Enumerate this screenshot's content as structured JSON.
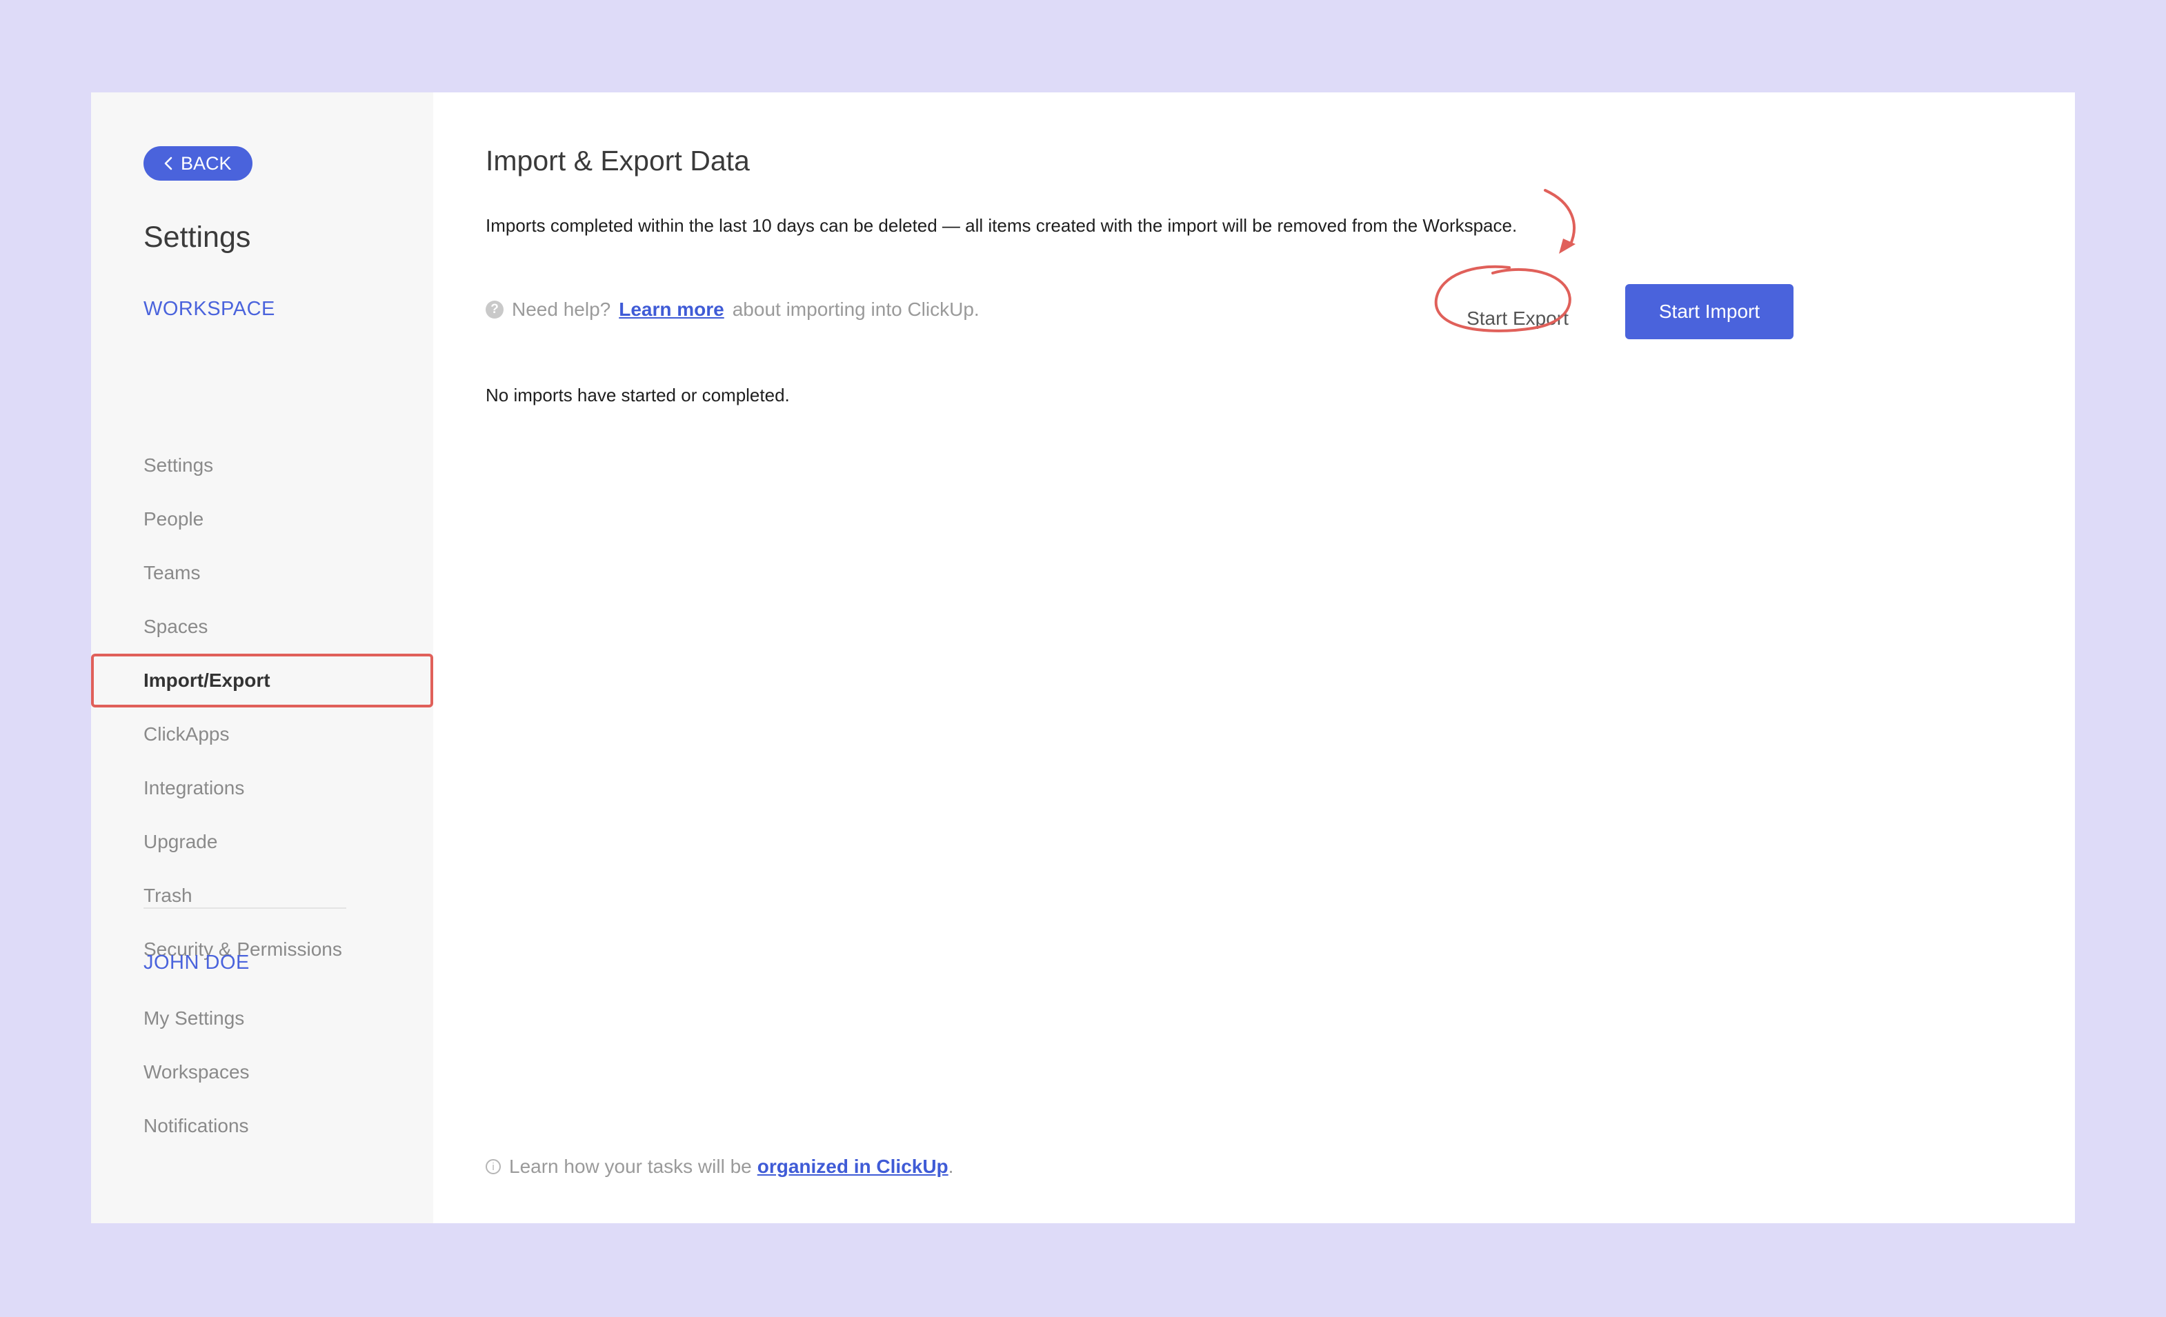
{
  "sidebar": {
    "back_label": "BACK",
    "title": "Settings",
    "workspace_heading": "WORKSPACE",
    "workspace_items": [
      {
        "label": "Settings"
      },
      {
        "label": "People"
      },
      {
        "label": "Teams"
      },
      {
        "label": "Spaces"
      },
      {
        "label": "Import/Export"
      },
      {
        "label": "ClickApps"
      },
      {
        "label": "Integrations"
      },
      {
        "label": "Upgrade"
      },
      {
        "label": "Trash"
      },
      {
        "label": "Security & Permissions"
      }
    ],
    "user_heading": "JOHN DOE",
    "user_items": [
      {
        "label": "My Settings"
      },
      {
        "label": "Workspaces"
      },
      {
        "label": "Notifications"
      }
    ]
  },
  "main": {
    "title": "Import & Export Data",
    "description": "Imports completed within the last 10 days can be deleted — all items created with the import will be removed from the Workspace.",
    "help": {
      "icon": "question-icon",
      "prefix": "Need help?",
      "link": "Learn more",
      "suffix": "about importing into ClickUp."
    },
    "export_button": "Start Export",
    "import_button": "Start Import",
    "empty_state": "No imports have started or completed.",
    "footer": {
      "icon": "info-icon",
      "prefix": "Learn how your tasks will be",
      "link": "organized in ClickUp",
      "suffix": "."
    }
  },
  "colors": {
    "accent": "#4a63dc",
    "annotation": "#e0605a",
    "background": "#dedbf8",
    "sidebar_bg": "#f7f7f7"
  }
}
